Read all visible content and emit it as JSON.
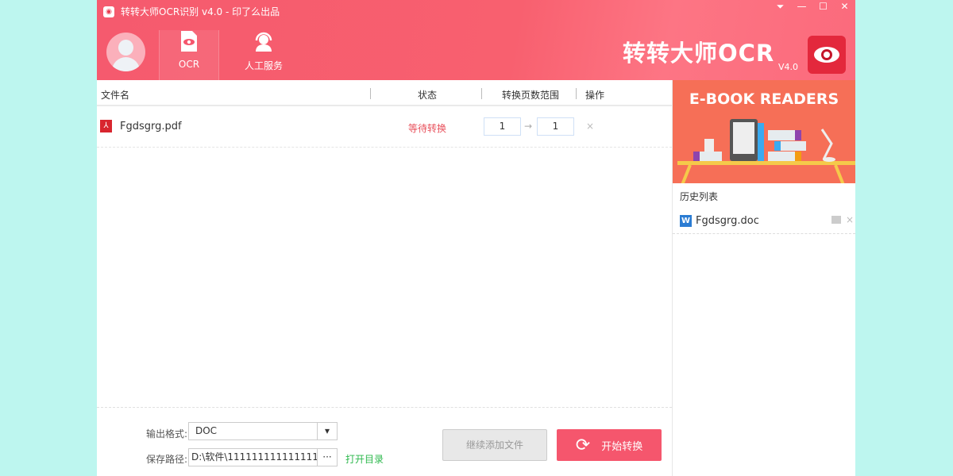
{
  "window": {
    "title": "转转大师OCR识别 v4.0 - 印了么出品"
  },
  "nav": [
    {
      "label": "OCR",
      "icon": "ocr-eye-icon"
    },
    {
      "label": "人工服务",
      "icon": "headset-icon"
    }
  ],
  "brand": {
    "name": "转转大师OCR",
    "version": "V4.0"
  },
  "table": {
    "headers": {
      "name": "文件名",
      "status": "状态",
      "range": "转换页数范围",
      "ops": "操作"
    },
    "rows": [
      {
        "name": "Fgdsgrg.pdf",
        "status": "等待转换",
        "from": "1",
        "to": "1",
        "arrow": "→",
        "remove": "×"
      }
    ]
  },
  "output": {
    "format_label": "输出格式:",
    "format_value": "DOC",
    "path_label": "保存路径:",
    "path_value": "D:\\软件\\11111111111111111",
    "browse": "···",
    "open_dir": "打开目录"
  },
  "buttons": {
    "add_more": "继续添加文件",
    "start": "开始转换"
  },
  "side": {
    "banner": "E-BOOK READERS",
    "history_title": "历史列表",
    "history": [
      {
        "name": "Fgdsgrg.doc",
        "icon_letter": "W",
        "remove": "×"
      }
    ]
  },
  "colors": {
    "accent": "#f5566d",
    "status": "#e8505b",
    "link": "#2db84d"
  }
}
